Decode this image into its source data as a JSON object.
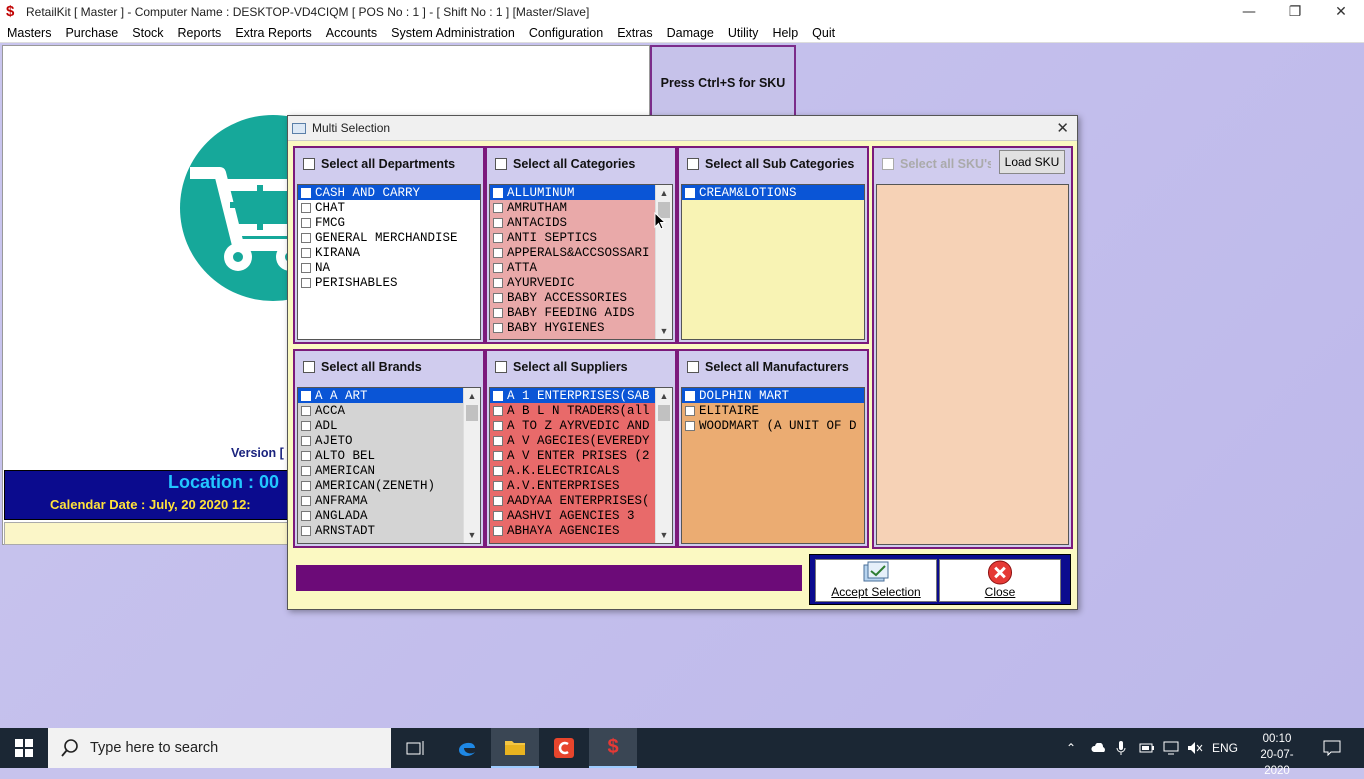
{
  "window": {
    "title": "RetailKit [ Master ] - Computer Name : DESKTOP-VD4CIQM [ POS No : 1 ] - [ Shift No : 1 ]  [Master/Slave]",
    "app_icon": "$"
  },
  "menu": [
    "Masters",
    "Purchase",
    "Stock",
    "Reports",
    "Extra Reports",
    "Accounts",
    "System Administration",
    "Configuration",
    "Extras",
    "Damage",
    "Utility",
    "Help",
    "Quit"
  ],
  "background": {
    "version_label": "Version [",
    "location_label": "Location : 00",
    "calendar_label": "Calendar Date : July, 20 2020 12:",
    "sku_hint": "Press Ctrl+S for SKU"
  },
  "dialog": {
    "title": "Multi Selection",
    "departments": {
      "header": "Select all Departments",
      "items": [
        "CASH AND CARRY",
        "CHAT",
        "FMCG",
        "GENERAL MERCHANDISE",
        "KIRANA",
        "NA",
        "PERISHABLES"
      ]
    },
    "categories": {
      "header": "Select all Categories",
      "items": [
        "ALLUMINUM",
        "AMRUTHAM",
        "ANTACIDS",
        "ANTI SEPTICS",
        "APPERALS&ACCSOSSARI",
        "ATTA",
        "AYURVEDIC",
        "BABY ACCESSORIES",
        "BABY FEEDING AIDS",
        "BABY HYGIENES"
      ]
    },
    "sub_categories": {
      "header": "Select all Sub Categories",
      "items": [
        "CREAM&LOTIONS"
      ]
    },
    "skus": {
      "header": "Select all SKU's",
      "load_button": "Load SKU"
    },
    "brands": {
      "header": "Select all Brands",
      "items": [
        "A A ART",
        "ACCA",
        "ADL",
        "AJETO",
        "ALTO BEL",
        "AMERICAN",
        "AMERICAN(ZENETH)",
        "ANFRAMA",
        "ANGLADA",
        "ARNSTADT"
      ]
    },
    "suppliers": {
      "header": "Select all Suppliers",
      "items": [
        "A 1 ENTERPRISES(SAB",
        "A B L N TRADERS(all",
        "A TO Z AYRVEDIC AND",
        "A V AGECIES(EVEREDY",
        "A V ENTER PRISES (2",
        "A.K.ELECTRICALS",
        "A.V.ENTERPRISES",
        "AADYAA ENTERPRISES(",
        "AASHVI AGENCIES   3",
        "ABHAYA AGENCIES"
      ]
    },
    "manufacturers": {
      "header": "Select all Manufacturers",
      "items": [
        "DOLPHIN MART",
        "ELITAIRE",
        "WOODMART (A UNIT OF D"
      ]
    },
    "accept_button": "Accept Selection",
    "close_button": "Close"
  },
  "taskbar": {
    "search_placeholder": "Type here to search",
    "language": "ENG",
    "time": "00:10",
    "date": "20-07-2020"
  },
  "colors": {
    "dept_bg": "#ffffff",
    "cat_bg": "#e9a9a9",
    "subcat_bg": "#f8f3b4",
    "sku_bg": "#f6d2b6",
    "brand_bg": "#d4d4d4",
    "supplier_bg": "#e86a6a",
    "manuf_bg": "#ebac72",
    "selection": "#0a55d6",
    "group_border": "#7b1a7b"
  }
}
